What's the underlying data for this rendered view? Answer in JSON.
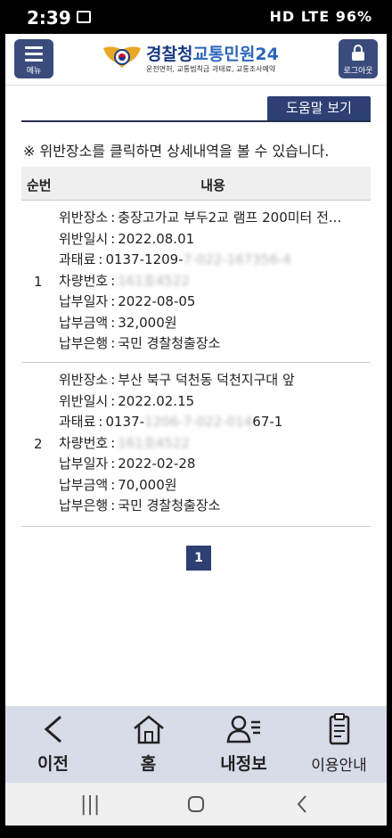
{
  "status_bar": {
    "time": "2:39",
    "right": "HD LTE 96%"
  },
  "header": {
    "menu_label": "메뉴",
    "logout_label": "로그아웃",
    "title_a": "경찰청",
    "title_b": "교통민원24",
    "subtitle": "운전면허, 교통범칙금 과태료, 교통조사예약"
  },
  "help_button": "도움말 보기",
  "notice": "※ 위반장소를 클릭하면 상세내역을 볼 수 있습니다.",
  "table": {
    "col_num": "순번",
    "col_content": "내용",
    "rows": [
      {
        "num": "1",
        "place_label": "위반장소",
        "place": "충장고가교 부두2교 램프 200미터 전...",
        "date_label": "위반일시",
        "date": "2022.08.01",
        "fine_label": "과태료",
        "fine": "0137-1209-",
        "car_label": "차량번호",
        "paydate_label": "납부일자",
        "paydate": "2022-08-05",
        "amount_label": "납부금액",
        "amount": "32,000원",
        "bank_label": "납부은행",
        "bank": "국민 경찰청출장소"
      },
      {
        "num": "2",
        "place_label": "위반장소",
        "place": "부산 북구 덕천동 덕천지구대 앞",
        "date_label": "위반일시",
        "date": "2022.02.15",
        "fine_label": "과태료",
        "fine": "0137-",
        "fine_tail": "67-1",
        "car_label": "차량번호",
        "paydate_label": "납부일자",
        "paydate": "2022-02-28",
        "amount_label": "납부금액",
        "amount": "70,000원",
        "bank_label": "납부은행",
        "bank": "국민 경찰청출장소"
      }
    ]
  },
  "pager": {
    "current": "1"
  },
  "bottom_nav": [
    {
      "label": "이전",
      "icon": "back-arrow-icon"
    },
    {
      "label": "홈",
      "icon": "home-icon"
    },
    {
      "label": "내정보",
      "icon": "user-info-icon"
    },
    {
      "label": "이용안내",
      "icon": "guide-clipboard-icon"
    }
  ],
  "colors": {
    "primary": "#2d3f73",
    "nav_bg": "#d8dbe8"
  }
}
